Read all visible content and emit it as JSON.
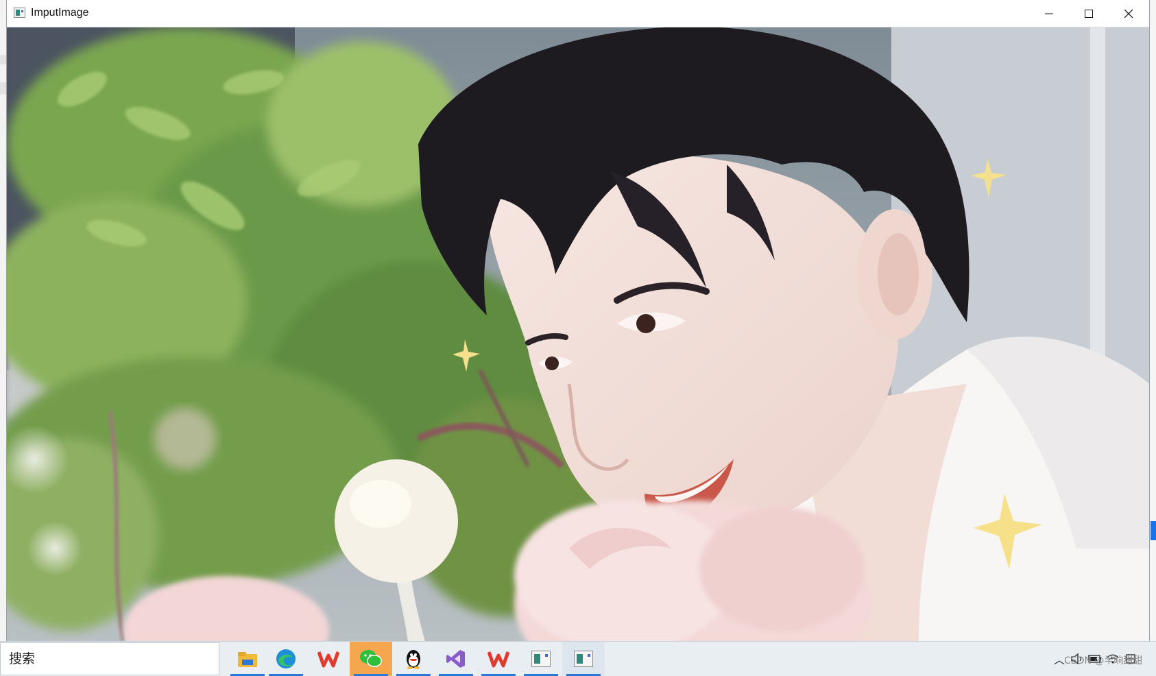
{
  "window": {
    "title": "ImputImage",
    "minimize_glyph": "—",
    "maximize_glyph": "☐",
    "close_glyph": "✕"
  },
  "image": {
    "content": "photo-portrait-with-flowers"
  },
  "taskbar": {
    "search_label": "搜索",
    "items": [
      {
        "icon": "file-explorer-icon",
        "color": "#f2b937"
      },
      {
        "icon": "edge-browser-icon",
        "color": "#1c8fd6"
      },
      {
        "icon": "wps-office-icon",
        "color": "#e23a2c"
      },
      {
        "icon": "wechat-icon",
        "color": "#2fbf3a",
        "active": true
      },
      {
        "icon": "qq-penguin-icon",
        "color": "#111111"
      },
      {
        "icon": "visual-studio-icon",
        "color": "#8a5cc9"
      },
      {
        "icon": "wps-office-icon",
        "color": "#e23a2c"
      },
      {
        "icon": "imputimage-app-icon",
        "color": "#2e8b7a"
      },
      {
        "icon": "imputimage-app-icon",
        "color": "#2e8b7a"
      }
    ],
    "tray": {
      "chevron_glyph": "︿",
      "watermark": "CSDN @半晌甜甜"
    }
  }
}
